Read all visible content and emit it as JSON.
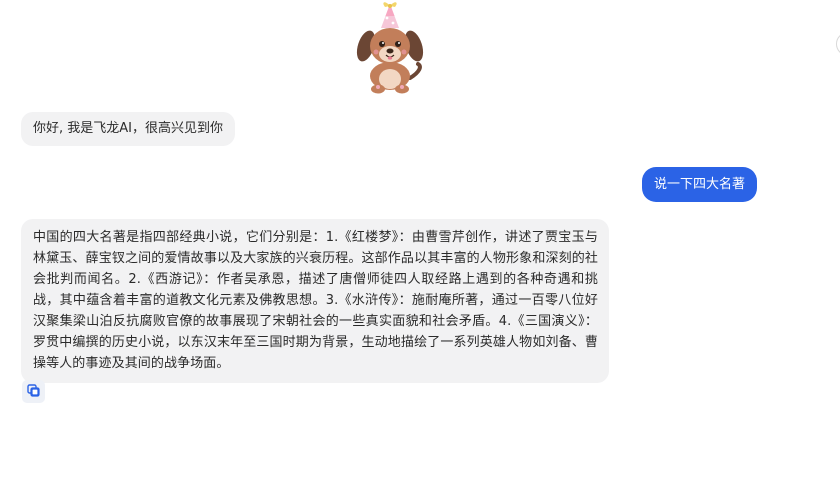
{
  "chat": {
    "greeting": "你好, 我是飞龙AI，很高兴见到你",
    "user_message": "说一下四大名著",
    "bot_answer": "中国的四大名著是指四部经典小说，它们分别是：1.《红楼梦》：由曹雪芹创作，讲述了贾宝玉与林黛玉、薛宝钗之间的爱情故事以及大家族的兴衰历程。这部作品以其丰富的人物形象和深刻的社会批判而闻名。2.《西游记》：作者吴承恩，描述了唐僧师徒四人取经路上遇到的各种奇遇和挑战，其中蕴含着丰富的道教文化元素及佛教思想。3.《水浒传》：施耐庵所著，通过一百零八位好汉聚集梁山泊反抗腐败官僚的故事展现了宋朝社会的一些真实面貌和社会矛盾。4.《三国演义》：罗贯中编撰的历史小说，以东汉末年至三国时期为背景，生动地描绘了一系列英雄人物如刘备、曹操等人的事迹及其间的战争场面。"
  },
  "icons": {
    "mascot": "puppy-with-party-hat-icon",
    "copy": "copy-icon"
  },
  "colors": {
    "user_bubble": "#2b63e6",
    "bot_bubble": "#f2f2f3",
    "copy_icon": "#2b63e6"
  }
}
